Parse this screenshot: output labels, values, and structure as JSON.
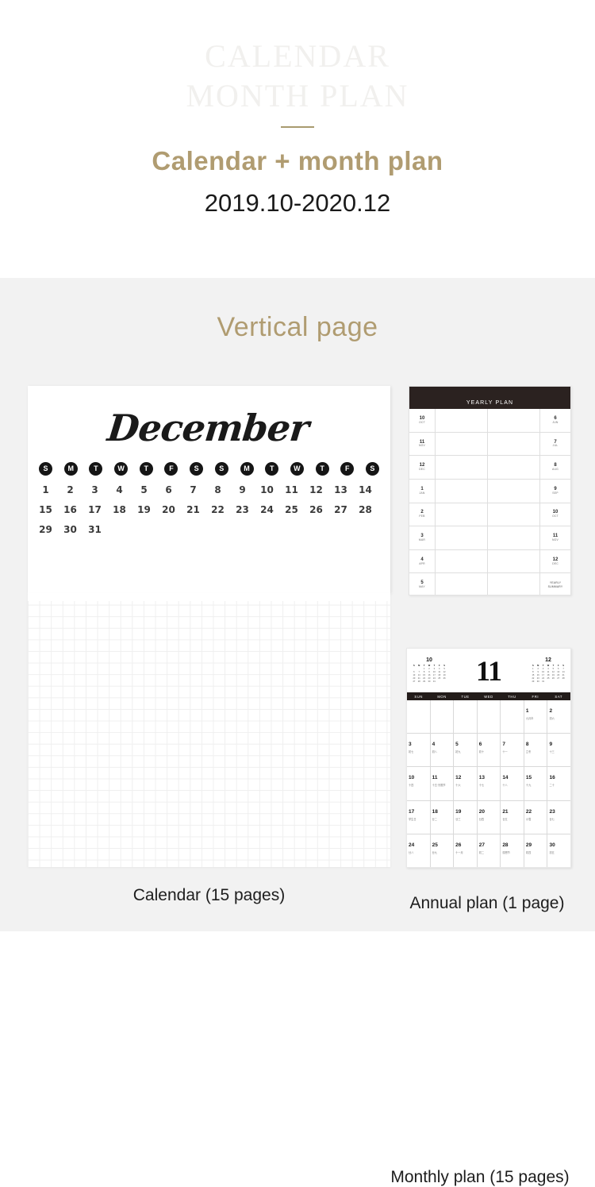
{
  "hero": {
    "ghost_line1": "CALENDAR",
    "ghost_line2": "MONTH PLAN",
    "title": "Calendar + month plan",
    "subtitle": "2019.10-2020.12",
    "accent_color": "#b09c71",
    "divider_color": "#a89a6f",
    "ghost_color": "#f1f0ee"
  },
  "section": {
    "title": "Vertical page",
    "background_color": "#f2f2f2"
  },
  "calendar_card": {
    "month_name": "December",
    "weekday_letters": [
      "S",
      "M",
      "T",
      "W",
      "T",
      "F",
      "S",
      "S",
      "M",
      "T",
      "W",
      "T",
      "F",
      "S"
    ],
    "rows": [
      [
        "1",
        "2",
        "3",
        "4",
        "5",
        "6",
        "7",
        "8",
        "9",
        "10",
        "11",
        "12",
        "13",
        "14"
      ],
      [
        "15",
        "16",
        "17",
        "18",
        "19",
        "20",
        "21",
        "22",
        "23",
        "24",
        "25",
        "26",
        "27",
        "28"
      ],
      [
        "29",
        "30",
        "31",
        "",
        "",
        "",
        "",
        "",
        "",
        "",
        "",
        "",
        "",
        ""
      ]
    ],
    "caption": "Calendar (15 pages)"
  },
  "yearly_plan": {
    "header": "YEARLY  PLAN",
    "header_color": "#2b2220",
    "rows": [
      {
        "left_num": "10",
        "left_abbr": "OCT",
        "right_num": "6",
        "right_abbr": "JUN"
      },
      {
        "left_num": "11",
        "left_abbr": "NOV",
        "right_num": "7",
        "right_abbr": "JUL"
      },
      {
        "left_num": "12",
        "left_abbr": "DEC",
        "right_num": "8",
        "right_abbr": "AUG"
      },
      {
        "left_num": "1",
        "left_abbr": "JAN",
        "right_num": "9",
        "right_abbr": "SEP"
      },
      {
        "left_num": "2",
        "left_abbr": "FEB",
        "right_num": "10",
        "right_abbr": "OCT"
      },
      {
        "left_num": "3",
        "left_abbr": "MAR",
        "right_num": "11",
        "right_abbr": "NOV"
      },
      {
        "left_num": "4",
        "left_abbr": "APR",
        "right_num": "12",
        "right_abbr": "DEC"
      },
      {
        "left_num": "5",
        "left_abbr": "MAY",
        "right_summary": "YEARLY SUMMARY"
      }
    ],
    "caption": "Annual plan (1 page)"
  },
  "monthly_plan": {
    "big_month": "11",
    "mini_prev": {
      "title": "10",
      "headers": [
        "S",
        "M",
        "T",
        "W",
        "T",
        "F",
        "S"
      ],
      "weeks": [
        [
          "",
          "",
          "1",
          "2",
          "3",
          "4",
          "5"
        ],
        [
          "6",
          "7",
          "8",
          "9",
          "10",
          "11",
          "12"
        ],
        [
          "13",
          "14",
          "15",
          "16",
          "17",
          "18",
          "19"
        ],
        [
          "20",
          "21",
          "22",
          "23",
          "24",
          "25",
          "26"
        ],
        [
          "27",
          "28",
          "29",
          "30",
          "31",
          "",
          ""
        ]
      ]
    },
    "mini_next": {
      "title": "12",
      "headers": [
        "S",
        "M",
        "T",
        "W",
        "T",
        "F",
        "S"
      ],
      "weeks": [
        [
          "1",
          "2",
          "3",
          "4",
          "5",
          "6",
          "7"
        ],
        [
          "8",
          "9",
          "10",
          "11",
          "12",
          "13",
          "14"
        ],
        [
          "15",
          "16",
          "17",
          "18",
          "19",
          "20",
          "21"
        ],
        [
          "22",
          "23",
          "24",
          "25",
          "26",
          "27",
          "28"
        ],
        [
          "29",
          "30",
          "31",
          "",
          "",
          "",
          ""
        ]
      ]
    },
    "weekday_headers": [
      "SUN",
      "MON",
      "TUE",
      "WED",
      "THU",
      "FRI",
      "SAT"
    ],
    "weeks": [
      [
        {
          "day": "",
          "label": ""
        },
        {
          "day": "",
          "label": ""
        },
        {
          "day": "",
          "label": ""
        },
        {
          "day": "",
          "label": ""
        },
        {
          "day": "",
          "label": ""
        },
        {
          "day": "1",
          "label": "九月半"
        },
        {
          "day": "2",
          "label": "初六"
        }
      ],
      [
        {
          "day": "3",
          "label": "初七"
        },
        {
          "day": "4",
          "label": "初八"
        },
        {
          "day": "5",
          "label": "初九"
        },
        {
          "day": "6",
          "label": "初十"
        },
        {
          "day": "7",
          "label": "十一"
        },
        {
          "day": "8",
          "label": "立冬"
        },
        {
          "day": "9",
          "label": "十三"
        }
      ],
      [
        {
          "day": "10",
          "label": "十四"
        },
        {
          "day": "11",
          "label": "十五·光棍节"
        },
        {
          "day": "12",
          "label": "十六"
        },
        {
          "day": "13",
          "label": "十七"
        },
        {
          "day": "14",
          "label": "十八"
        },
        {
          "day": "15",
          "label": "十九"
        },
        {
          "day": "16",
          "label": "二十"
        }
      ],
      [
        {
          "day": "17",
          "label": "学生日"
        },
        {
          "day": "18",
          "label": "廿二"
        },
        {
          "day": "19",
          "label": "廿三"
        },
        {
          "day": "20",
          "label": "廿四"
        },
        {
          "day": "21",
          "label": "廿五"
        },
        {
          "day": "22",
          "label": "小雪"
        },
        {
          "day": "23",
          "label": "廿七"
        }
      ],
      [
        {
          "day": "24",
          "label": "廿八"
        },
        {
          "day": "25",
          "label": "廿九"
        },
        {
          "day": "26",
          "label": "十一月"
        },
        {
          "day": "27",
          "label": "初二"
        },
        {
          "day": "28",
          "label": "感恩节"
        },
        {
          "day": "29",
          "label": "初四"
        },
        {
          "day": "30",
          "label": "初五"
        }
      ]
    ],
    "caption": "Monthly plan (15 pages)"
  }
}
